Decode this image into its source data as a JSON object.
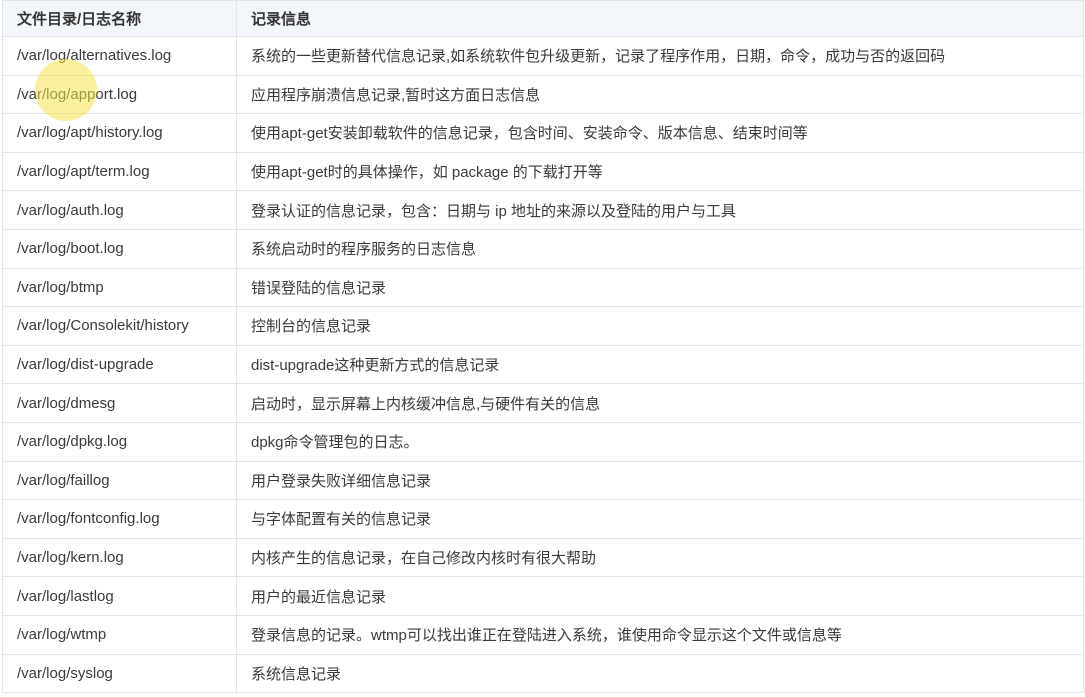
{
  "table": {
    "headers": [
      "文件目录/日志名称",
      "记录信息"
    ],
    "rows": [
      [
        "/var/log/alternatives.log",
        "系统的一些更新替代信息记录,如系统软件包升级更新，记录了程序作用，日期，命令，成功与否的返回码"
      ],
      [
        "/var/log/apport.log",
        "应用程序崩溃信息记录,暂时这方面日志信息"
      ],
      [
        "/var/log/apt/history.log",
        "使用apt-get安装卸载软件的信息记录，包含时间、安装命令、版本信息、结束时间等"
      ],
      [
        "/var/log/apt/term.log",
        "使用apt-get时的具体操作，如 package 的下载打开等"
      ],
      [
        "/var/log/auth.log",
        "登录认证的信息记录，包含：日期与 ip 地址的来源以及登陆的用户与工具"
      ],
      [
        "/var/log/boot.log",
        "系统启动时的程序服务的日志信息"
      ],
      [
        "/var/log/btmp",
        "错误登陆的信息记录"
      ],
      [
        "/var/log/Consolekit/history",
        "控制台的信息记录"
      ],
      [
        "/var/log/dist-upgrade",
        "dist-upgrade这种更新方式的信息记录"
      ],
      [
        "/var/log/dmesg",
        "启动时，显示屏幕上内核缓冲信息,与硬件有关的信息"
      ],
      [
        "/var/log/dpkg.log",
        "dpkg命令管理包的日志。"
      ],
      [
        "/var/log/faillog",
        "用户登录失败详细信息记录"
      ],
      [
        "/var/log/fontconfig.log",
        "与字体配置有关的信息记录"
      ],
      [
        "/var/log/kern.log",
        "内核产生的信息记录，在自己修改内核时有很大帮助"
      ],
      [
        "/var/log/lastlog",
        "用户的最近信息记录"
      ],
      [
        "/var/log/wtmp",
        "登录信息的记录。wtmp可以找出谁正在登陆进入系统，谁使用命令显示这个文件或信息等"
      ],
      [
        "/var/log/syslog",
        "系统信息记录"
      ]
    ]
  }
}
